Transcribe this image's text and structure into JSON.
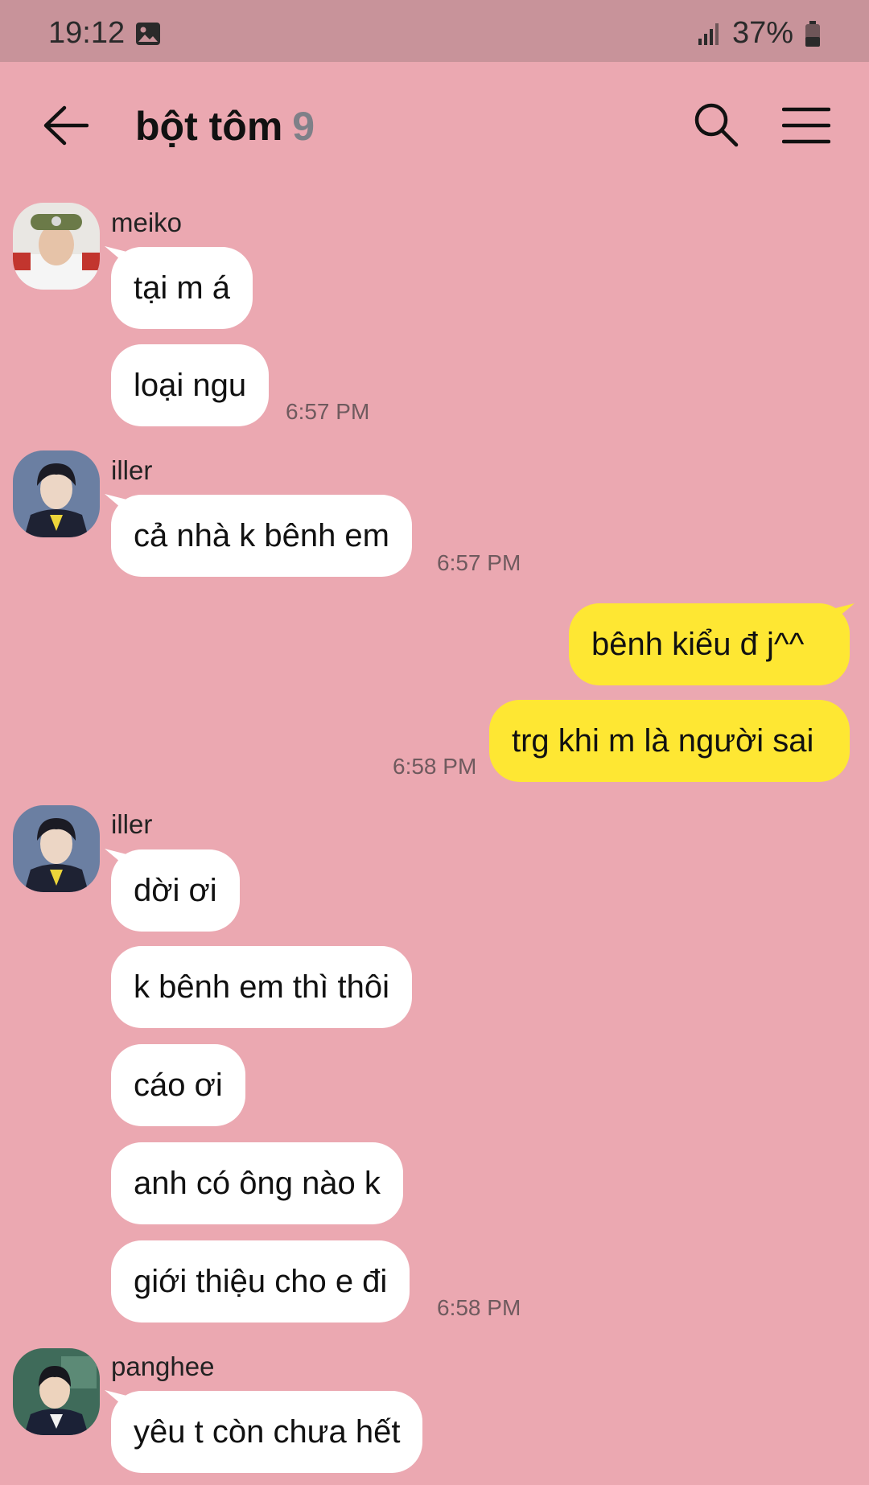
{
  "status_bar": {
    "time": "19:12",
    "battery": "37%",
    "icons": [
      "photo-icon",
      "signal-icon",
      "battery-icon"
    ]
  },
  "header": {
    "title": "bột tôm",
    "member_count": "9",
    "icons": [
      "back-arrow-icon",
      "search-icon",
      "menu-icon"
    ]
  },
  "colors": {
    "background": "#eba8b1",
    "status_bar": "#c8939a",
    "incoming_bubble": "#ffffff",
    "outgoing_bubble": "#fee733"
  },
  "messages": [
    {
      "sender": "meiko",
      "text": "tại m á"
    },
    {
      "sender": "meiko",
      "text": "loại ngu",
      "time": "6:57 PM"
    },
    {
      "sender": "iller",
      "text": "cả nhà k bênh em",
      "time": "6:57 PM"
    },
    {
      "sender": "me",
      "text": "bênh kiểu đ j^^"
    },
    {
      "sender": "me",
      "text": "trg khi m là người sai",
      "time": "6:58 PM"
    },
    {
      "sender": "iller",
      "text": "dời ơi"
    },
    {
      "sender": "iller",
      "text": "k bênh em thì thôi"
    },
    {
      "sender": "iller",
      "text": "cáo ơi"
    },
    {
      "sender": "iller",
      "text": "anh có ông nào k"
    },
    {
      "sender": "iller",
      "text": "giới thiệu cho e đi",
      "time": "6:58 PM"
    },
    {
      "sender": "panghee",
      "text": "yêu t còn chưa hết"
    }
  ]
}
